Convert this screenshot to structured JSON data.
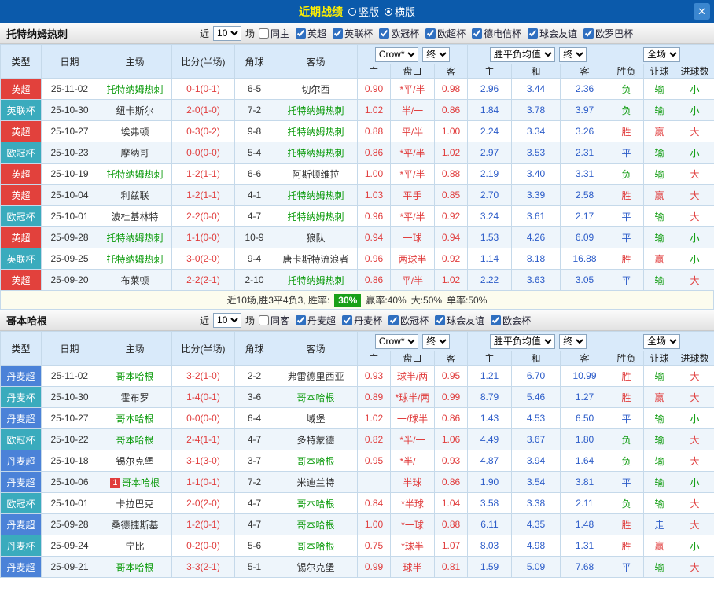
{
  "topbar": {
    "title": "近期战绩",
    "options": [
      {
        "label": "竖版",
        "selected": false
      },
      {
        "label": "横版",
        "selected": true
      }
    ],
    "close_icon": "✕"
  },
  "colors": {
    "topbar_blue": "#0b5aab",
    "title_yellow": "#ffef00",
    "league_red": "#e2413c",
    "league_teal": "#3aabbd",
    "league_blue": "#4b82d8",
    "win_red": "#e03c3c",
    "draw_blue": "#2b5bc8",
    "lose_green": "#0a9a0a",
    "badge_green": "#18a018"
  },
  "sections": [
    {
      "team": "托特纳姆热刺",
      "near_label": "近",
      "near_value": "10",
      "matches_label": "场",
      "filters": [
        {
          "label": "同主",
          "checked": false
        },
        {
          "label": "英超",
          "checked": true
        },
        {
          "label": "英联杯",
          "checked": true
        },
        {
          "label": "欧冠杯",
          "checked": true
        },
        {
          "label": "欧超杯",
          "checked": true
        },
        {
          "label": "德电信杯",
          "checked": true
        },
        {
          "label": "球会友谊",
          "checked": true
        },
        {
          "label": "欧罗巴杯",
          "checked": true
        }
      ],
      "header": {
        "col_type": "类型",
        "col_date": "日期",
        "col_home": "主场",
        "col_score": "比分(半场)",
        "col_corner": "角球",
        "col_away": "客场",
        "dd_company": "Crow*",
        "dd_final_a": "终",
        "dd_avg": "胜平负均值",
        "dd_final_b": "终",
        "dd_scope": "全场",
        "sub": [
          "主",
          "盘口",
          "客",
          "主",
          "和",
          "客",
          "胜负",
          "让球",
          "进球数"
        ]
      },
      "rows": [
        {
          "league": "英超",
          "league_color": "red",
          "date": "25-11-02",
          "home": "托特纳姆热刺",
          "home_self": true,
          "score": "0-1(0-1)",
          "corner": "6-5",
          "away": "切尔西",
          "away_self": false,
          "o_home": "0.90",
          "handicap": "*平/半",
          "o_away": "0.98",
          "e_home": "2.96",
          "e_draw": "3.44",
          "e_away": "2.36",
          "res": "负",
          "res_color": "green",
          "ah": "输",
          "ah_color": "green",
          "ou": "小",
          "ou_color": "green"
        },
        {
          "league": "英联杯",
          "league_color": "teal",
          "date": "25-10-30",
          "home": "纽卡斯尔",
          "home_self": false,
          "score": "2-0(1-0)",
          "corner": "7-2",
          "away": "托特纳姆热刺",
          "away_self": true,
          "o_home": "1.02",
          "handicap": "半/一",
          "o_away": "0.86",
          "e_home": "1.84",
          "e_draw": "3.78",
          "e_away": "3.97",
          "res": "负",
          "res_color": "green",
          "ah": "输",
          "ah_color": "green",
          "ou": "小",
          "ou_color": "green"
        },
        {
          "league": "英超",
          "league_color": "red",
          "date": "25-10-27",
          "home": "埃弗顿",
          "home_self": false,
          "score": "0-3(0-2)",
          "corner": "9-8",
          "away": "托特纳姆热刺",
          "away_self": true,
          "o_home": "0.88",
          "handicap": "平/半",
          "o_away": "1.00",
          "e_home": "2.24",
          "e_draw": "3.34",
          "e_away": "3.26",
          "res": "胜",
          "res_color": "red",
          "ah": "赢",
          "ah_color": "red",
          "ou": "大",
          "ou_color": "red"
        },
        {
          "league": "欧冠杯",
          "league_color": "teal",
          "date": "25-10-23",
          "home": "摩纳哥",
          "home_self": false,
          "score": "0-0(0-0)",
          "corner": "5-4",
          "away": "托特纳姆热刺",
          "away_self": true,
          "o_home": "0.86",
          "handicap": "*平/半",
          "o_away": "1.02",
          "e_home": "2.97",
          "e_draw": "3.53",
          "e_away": "2.31",
          "res": "平",
          "res_color": "blue",
          "ah": "输",
          "ah_color": "green",
          "ou": "小",
          "ou_color": "green"
        },
        {
          "league": "英超",
          "league_color": "red",
          "date": "25-10-19",
          "home": "托特纳姆热刺",
          "home_self": true,
          "score": "1-2(1-1)",
          "corner": "6-6",
          "away": "阿斯顿维拉",
          "away_self": false,
          "o_home": "1.00",
          "handicap": "*平/半",
          "o_away": "0.88",
          "e_home": "2.19",
          "e_draw": "3.40",
          "e_away": "3.31",
          "res": "负",
          "res_color": "green",
          "ah": "输",
          "ah_color": "green",
          "ou": "大",
          "ou_color": "red"
        },
        {
          "league": "英超",
          "league_color": "red",
          "date": "25-10-04",
          "home": "利兹联",
          "home_self": false,
          "score": "1-2(1-1)",
          "corner": "4-1",
          "away": "托特纳姆热刺",
          "away_self": true,
          "o_home": "1.03",
          "handicap": "平手",
          "o_away": "0.85",
          "e_home": "2.70",
          "e_draw": "3.39",
          "e_away": "2.58",
          "res": "胜",
          "res_color": "red",
          "ah": "赢",
          "ah_color": "red",
          "ou": "大",
          "ou_color": "red"
        },
        {
          "league": "欧冠杯",
          "league_color": "teal",
          "date": "25-10-01",
          "home": "波杜基林特",
          "home_self": false,
          "score": "2-2(0-0)",
          "corner": "4-7",
          "away": "托特纳姆热刺",
          "away_self": true,
          "o_home": "0.96",
          "handicap": "*平/半",
          "o_away": "0.92",
          "e_home": "3.24",
          "e_draw": "3.61",
          "e_away": "2.17",
          "res": "平",
          "res_color": "blue",
          "ah": "输",
          "ah_color": "green",
          "ou": "大",
          "ou_color": "red"
        },
        {
          "league": "英超",
          "league_color": "red",
          "date": "25-09-28",
          "home": "托特纳姆热刺",
          "home_self": true,
          "score": "1-1(0-0)",
          "corner": "10-9",
          "away": "狼队",
          "away_self": false,
          "o_home": "0.94",
          "handicap": "一球",
          "o_away": "0.94",
          "e_home": "1.53",
          "e_draw": "4.26",
          "e_away": "6.09",
          "res": "平",
          "res_color": "blue",
          "ah": "输",
          "ah_color": "green",
          "ou": "小",
          "ou_color": "green"
        },
        {
          "league": "英联杯",
          "league_color": "teal",
          "date": "25-09-25",
          "home": "托特纳姆热刺",
          "home_self": true,
          "score": "3-0(2-0)",
          "corner": "9-4",
          "away": "唐卡斯特流浪者",
          "away_self": false,
          "o_home": "0.96",
          "handicap": "两球半",
          "o_away": "0.92",
          "e_home": "1.14",
          "e_draw": "8.18",
          "e_away": "16.88",
          "res": "胜",
          "res_color": "red",
          "ah": "赢",
          "ah_color": "red",
          "ou": "小",
          "ou_color": "green"
        },
        {
          "league": "英超",
          "league_color": "red",
          "date": "25-09-20",
          "home": "布莱顿",
          "home_self": false,
          "score": "2-2(2-1)",
          "corner": "2-10",
          "away": "托特纳姆热刺",
          "away_self": true,
          "o_home": "0.86",
          "handicap": "平/半",
          "o_away": "1.02",
          "e_home": "2.22",
          "e_draw": "3.63",
          "e_away": "3.05",
          "res": "平",
          "res_color": "blue",
          "ah": "输",
          "ah_color": "green",
          "ou": "大",
          "ou_color": "red"
        }
      ],
      "summary": {
        "text": "近10场,胜3平4负3, 胜率:",
        "win_rate": "30%",
        "stats": [
          "赢率:40%",
          "大:50%",
          "单率:50%"
        ]
      }
    },
    {
      "team": "哥本哈根",
      "near_label": "近",
      "near_value": "10",
      "matches_label": "场",
      "filters": [
        {
          "label": "同客",
          "checked": false
        },
        {
          "label": "丹麦超",
          "checked": true
        },
        {
          "label": "丹麦杯",
          "checked": true
        },
        {
          "label": "欧冠杯",
          "checked": true
        },
        {
          "label": "球会友谊",
          "checked": true
        },
        {
          "label": "欧会杯",
          "checked": true
        }
      ],
      "header": {
        "col_type": "类型",
        "col_date": "日期",
        "col_home": "主场",
        "col_score": "比分(半场)",
        "col_corner": "角球",
        "col_away": "客场",
        "dd_company": "Crow*",
        "dd_final_a": "终",
        "dd_avg": "胜平负均值",
        "dd_final_b": "终",
        "dd_scope": "全场",
        "sub": [
          "主",
          "盘口",
          "客",
          "主",
          "和",
          "客",
          "胜负",
          "让球",
          "进球数"
        ]
      },
      "rows": [
        {
          "league": "丹麦超",
          "league_color": "blue",
          "date": "25-11-02",
          "home": "哥本哈根",
          "home_self": true,
          "score": "3-2(1-0)",
          "corner": "2-2",
          "away": "弗雷德里西亚",
          "away_self": false,
          "o_home": "0.93",
          "handicap": "球半/两",
          "o_away": "0.95",
          "e_home": "1.21",
          "e_draw": "6.70",
          "e_away": "10.99",
          "res": "胜",
          "res_color": "red",
          "ah": "输",
          "ah_color": "green",
          "ou": "大",
          "ou_color": "red"
        },
        {
          "league": "丹麦杯",
          "league_color": "teal",
          "date": "25-10-30",
          "home": "霍布罗",
          "home_self": false,
          "score": "1-4(0-1)",
          "corner": "3-6",
          "away": "哥本哈根",
          "away_self": true,
          "o_home": "0.89",
          "handicap": "*球半/两",
          "o_away": "0.99",
          "e_home": "8.79",
          "e_draw": "5.46",
          "e_away": "1.27",
          "res": "胜",
          "res_color": "red",
          "ah": "赢",
          "ah_color": "red",
          "ou": "大",
          "ou_color": "red"
        },
        {
          "league": "丹麦超",
          "league_color": "blue",
          "date": "25-10-27",
          "home": "哥本哈根",
          "home_self": true,
          "score": "0-0(0-0)",
          "corner": "6-4",
          "away": "域堡",
          "away_self": false,
          "o_home": "1.02",
          "handicap": "一/球半",
          "o_away": "0.86",
          "e_home": "1.43",
          "e_draw": "4.53",
          "e_away": "6.50",
          "res": "平",
          "res_color": "blue",
          "ah": "输",
          "ah_color": "green",
          "ou": "小",
          "ou_color": "green"
        },
        {
          "league": "欧冠杯",
          "league_color": "teal",
          "date": "25-10-22",
          "home": "哥本哈根",
          "home_self": true,
          "score": "2-4(1-1)",
          "corner": "4-7",
          "away": "多特蒙德",
          "away_self": false,
          "o_home": "0.82",
          "handicap": "*半/一",
          "o_away": "1.06",
          "e_home": "4.49",
          "e_draw": "3.67",
          "e_away": "1.80",
          "res": "负",
          "res_color": "green",
          "ah": "输",
          "ah_color": "green",
          "ou": "大",
          "ou_color": "red"
        },
        {
          "league": "丹麦超",
          "league_color": "blue",
          "date": "25-10-18",
          "home": "锡尔克堡",
          "home_self": false,
          "score": "3-1(3-0)",
          "corner": "3-7",
          "away": "哥本哈根",
          "away_self": true,
          "o_home": "0.95",
          "handicap": "*半/一",
          "o_away": "0.93",
          "e_home": "4.87",
          "e_draw": "3.94",
          "e_away": "1.64",
          "res": "负",
          "res_color": "green",
          "ah": "输",
          "ah_color": "green",
          "ou": "大",
          "ou_color": "red"
        },
        {
          "league": "丹麦超",
          "league_color": "blue",
          "date": "25-10-06",
          "home": "哥本哈根",
          "home_self": true,
          "home_badge": "1",
          "score": "1-1(0-1)",
          "corner": "7-2",
          "away": "米迪兰特",
          "away_self": false,
          "o_home": "",
          "handicap": "半球",
          "o_away": "0.86",
          "e_home": "1.90",
          "e_draw": "3.54",
          "e_away": "3.81",
          "res": "平",
          "res_color": "blue",
          "ah": "输",
          "ah_color": "green",
          "ou": "小",
          "ou_color": "green"
        },
        {
          "league": "欧冠杯",
          "league_color": "teal",
          "date": "25-10-01",
          "home": "卡拉巴克",
          "home_self": false,
          "score": "2-0(2-0)",
          "corner": "4-7",
          "away": "哥本哈根",
          "away_self": true,
          "o_home": "0.84",
          "handicap": "*半球",
          "o_away": "1.04",
          "e_home": "3.58",
          "e_draw": "3.38",
          "e_away": "2.11",
          "res": "负",
          "res_color": "green",
          "ah": "输",
          "ah_color": "green",
          "ou": "大",
          "ou_color": "red"
        },
        {
          "league": "丹麦超",
          "league_color": "blue",
          "date": "25-09-28",
          "home": "桑德捷斯基",
          "home_self": false,
          "score": "1-2(0-1)",
          "corner": "4-7",
          "away": "哥本哈根",
          "away_self": true,
          "o_home": "1.00",
          "handicap": "*一球",
          "o_away": "0.88",
          "e_home": "6.11",
          "e_draw": "4.35",
          "e_away": "1.48",
          "res": "胜",
          "res_color": "red",
          "ah": "走",
          "ah_color": "blue",
          "ou": "大",
          "ou_color": "red"
        },
        {
          "league": "丹麦杯",
          "league_color": "teal",
          "date": "25-09-24",
          "home": "宁比",
          "home_self": false,
          "score": "0-2(0-0)",
          "corner": "5-6",
          "away": "哥本哈根",
          "away_self": true,
          "o_home": "0.75",
          "handicap": "*球半",
          "o_away": "1.07",
          "e_home": "8.03",
          "e_draw": "4.98",
          "e_away": "1.31",
          "res": "胜",
          "res_color": "red",
          "ah": "赢",
          "ah_color": "red",
          "ou": "小",
          "ou_color": "green"
        },
        {
          "league": "丹麦超",
          "league_color": "blue",
          "date": "25-09-21",
          "home": "哥本哈根",
          "home_self": true,
          "score": "3-3(2-1)",
          "corner": "5-1",
          "away": "锡尔克堡",
          "away_self": false,
          "o_home": "0.99",
          "handicap": "球半",
          "o_away": "0.81",
          "e_home": "1.59",
          "e_draw": "5.09",
          "e_away": "7.68",
          "res": "平",
          "res_color": "blue",
          "ah": "输",
          "ah_color": "green",
          "ou": "大",
          "ou_color": "red"
        }
      ],
      "summary": null
    }
  ]
}
